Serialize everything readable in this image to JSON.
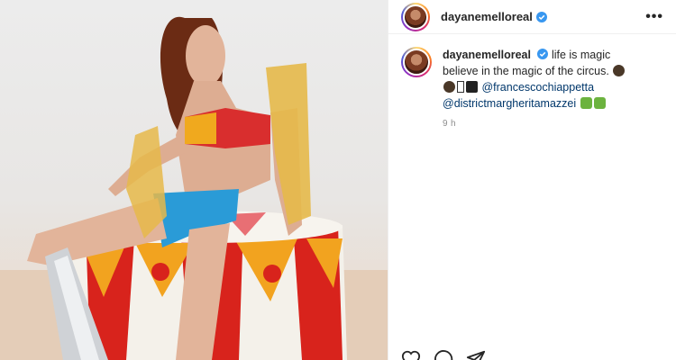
{
  "post": {
    "username": "dayanemelloreal",
    "caption_line1": "life is magic",
    "caption_line2": "believe in the magic of the circus.",
    "mention1": "@francescochiappetta",
    "mention2": "@districtmargheritamazzei",
    "time": "9 h"
  },
  "icons": {
    "verified": "verified-badge-icon",
    "more": "more-options-icon",
    "like": "heart-icon",
    "comment": "comment-icon",
    "share": "share-icon"
  },
  "colors": {
    "verified_blue": "#3897f0",
    "mention": "#00376b",
    "muted": "#8e8e8e"
  }
}
